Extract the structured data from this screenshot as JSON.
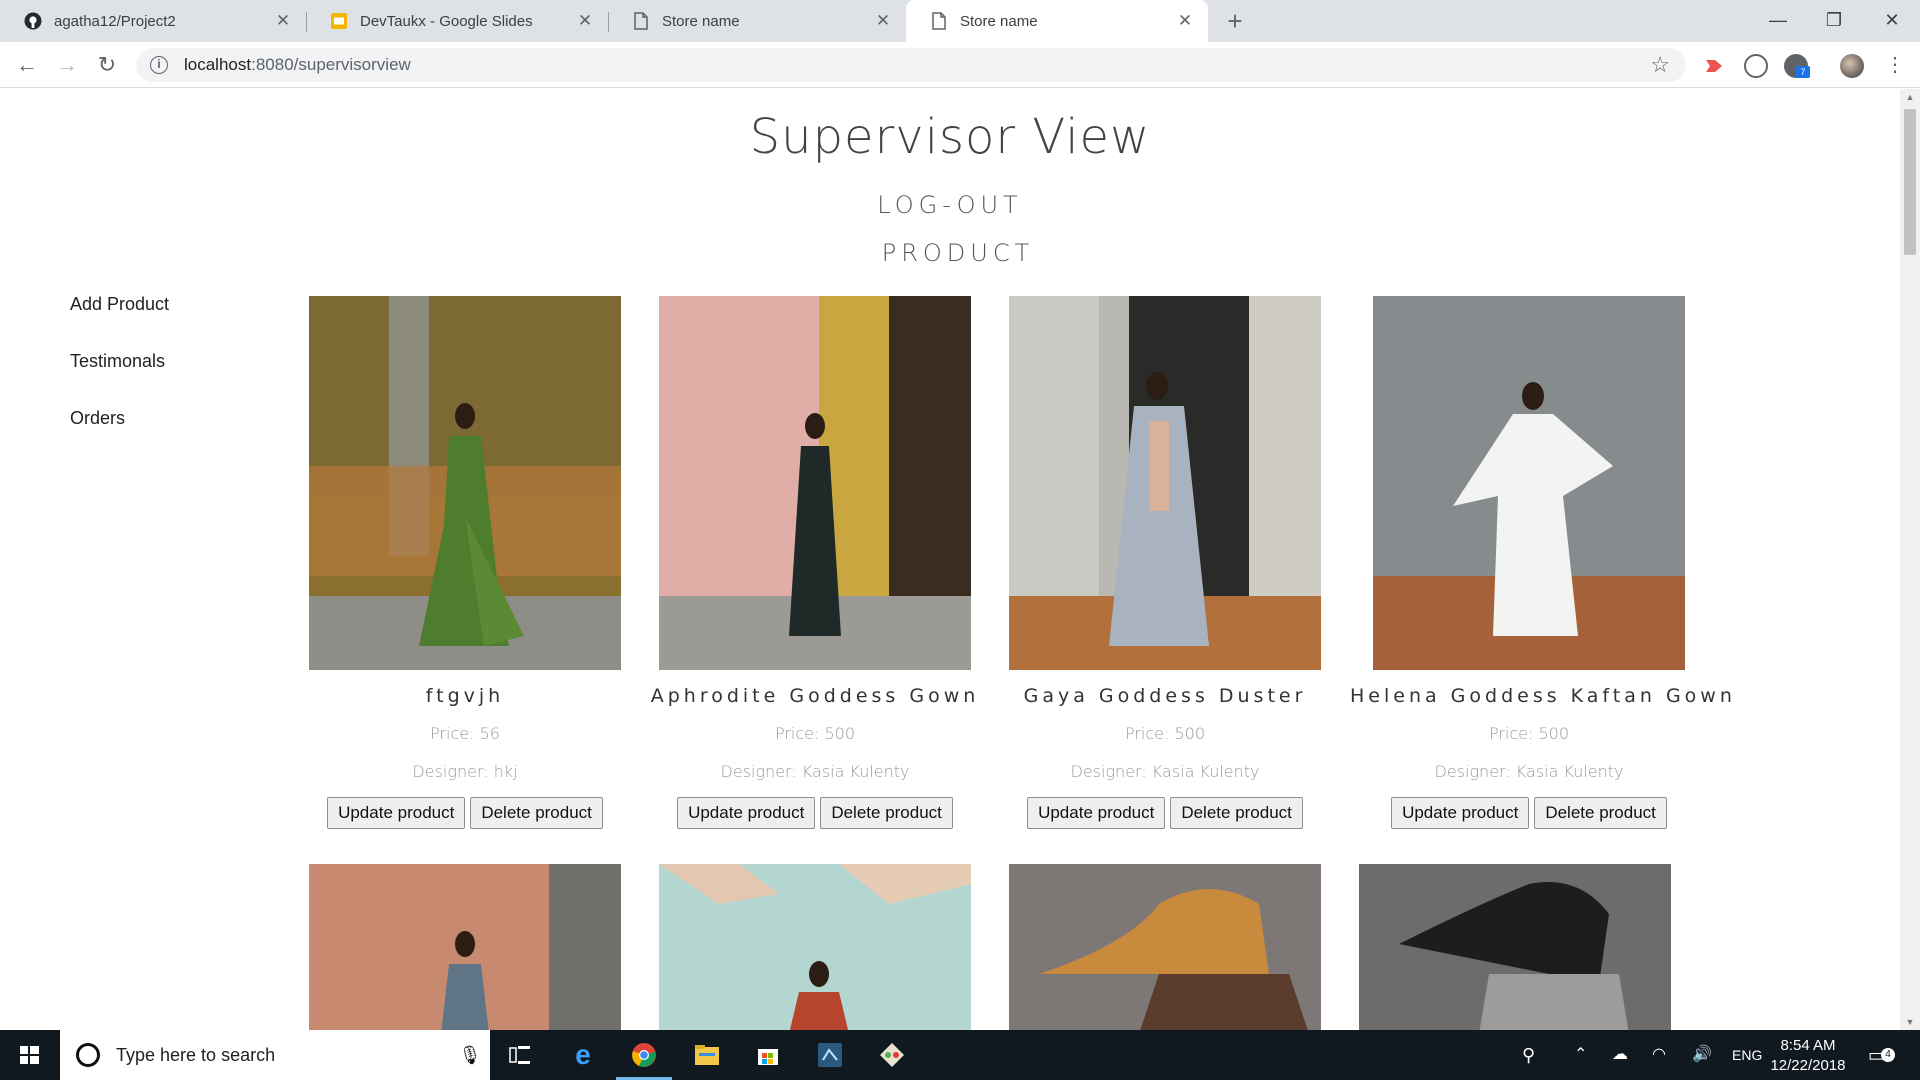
{
  "browser": {
    "tabs": [
      {
        "title": "agatha12/Project2",
        "icon": "github-icon",
        "active": false
      },
      {
        "title": "DevTaukx - Google Slides",
        "icon": "slides-icon",
        "active": false
      },
      {
        "title": "Store name",
        "icon": "page-icon",
        "active": false
      },
      {
        "title": "Store name",
        "icon": "page-icon",
        "active": true
      }
    ],
    "address": {
      "host": "localhost",
      "path": ":8080/supervisorview"
    }
  },
  "page": {
    "title": "Supervisor View",
    "logout": "LOG-OUT",
    "section": "PRODUCT",
    "sidebar": [
      {
        "label": "Add Product"
      },
      {
        "label": "Testimonals"
      },
      {
        "label": "Orders"
      }
    ],
    "products": [
      {
        "name": "ftgvjh",
        "price": "Price: 56",
        "designer": "Designer: hkj",
        "update": "Update product",
        "delete": "Delete product",
        "photo": "green-gown"
      },
      {
        "name": "Aphrodite Goddess Gown",
        "price": "Price: 500",
        "designer": "Designer: Kasia Kulenty",
        "update": "Update product",
        "delete": "Delete product",
        "photo": "black-gown"
      },
      {
        "name": "Gaya Goddess Duster",
        "price": "Price: 500",
        "designer": "Designer: Kasia Kulenty",
        "update": "Update product",
        "delete": "Delete product",
        "photo": "grey-duster"
      },
      {
        "name": "Helena Goddess Kaftan Gown",
        "price": "Price: 500",
        "designer": "Designer: Kasia Kulenty",
        "update": "Update product",
        "delete": "Delete product",
        "photo": "white-kaftan"
      }
    ],
    "second_row_photos": [
      "blue-gown",
      "red-top",
      "tan-cap",
      "black-cap"
    ]
  },
  "taskbar": {
    "search_placeholder": "Type here to search",
    "language": "ENG",
    "time": "8:54 AM",
    "date": "12/22/2018",
    "notifications": "4"
  },
  "colors": {
    "accent": "#76b9ed",
    "taskbar": "#101820",
    "tabbar": "#dee1e6"
  }
}
